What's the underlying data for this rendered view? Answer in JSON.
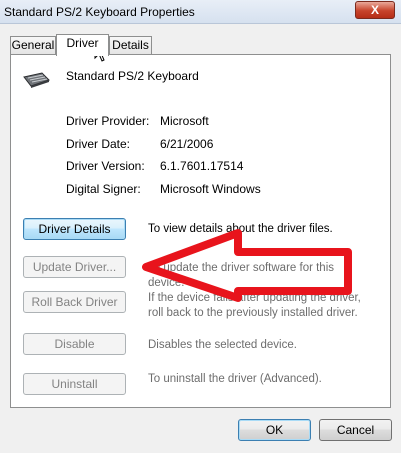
{
  "window": {
    "title": "Standard PS/2 Keyboard Properties",
    "close_glyph": "X"
  },
  "tabs": [
    {
      "label": "General",
      "active": false
    },
    {
      "label": "Driver",
      "active": true
    },
    {
      "label": "Details",
      "active": false
    }
  ],
  "device": {
    "name": "Standard PS/2 Keyboard",
    "icon": "keyboard-icon"
  },
  "properties": [
    {
      "label": "Driver Provider:",
      "value": "Microsoft"
    },
    {
      "label": "Driver Date:",
      "value": "6/21/2006"
    },
    {
      "label": "Driver Version:",
      "value": "6.1.7601.17514"
    },
    {
      "label": "Digital Signer:",
      "value": "Microsoft Windows"
    }
  ],
  "actions": [
    {
      "label": "Driver Details",
      "description": "To view details about the driver files.",
      "enabled": true
    },
    {
      "label": "Update Driver...",
      "description": "To update the driver software for this device.",
      "enabled": false
    },
    {
      "label": "Roll Back Driver",
      "description": "If the device fails after updating the driver, roll back to the previously installed driver.",
      "enabled": false
    },
    {
      "label": "Disable",
      "description": "Disables the selected device.",
      "enabled": false
    },
    {
      "label": "Uninstall",
      "description": "To uninstall the driver (Advanced).",
      "enabled": false
    }
  ],
  "footer": {
    "ok_label": "OK",
    "cancel_label": "Cancel"
  },
  "annotation": {
    "arrow_color": "#e8141c"
  }
}
